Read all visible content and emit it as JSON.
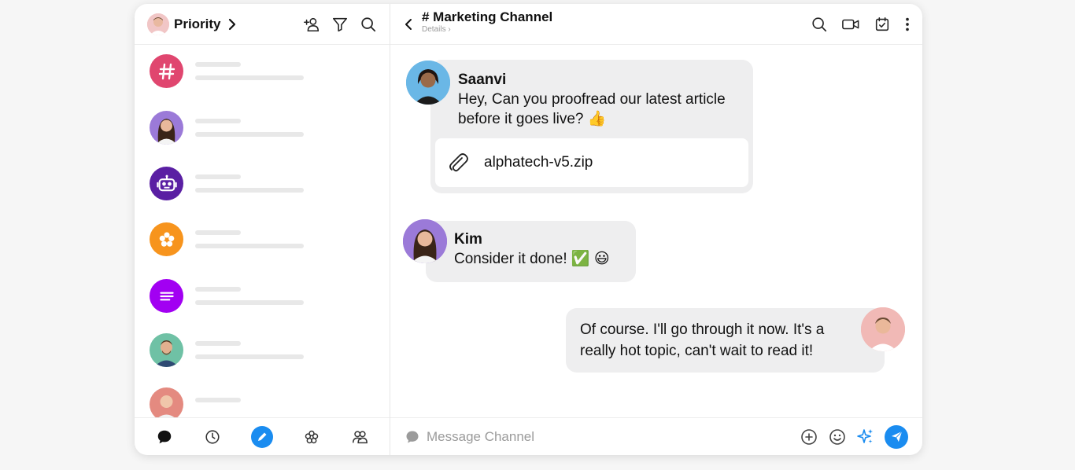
{
  "sidebar": {
    "title": "Priority",
    "icons": [
      "add-contact-icon",
      "filter-icon",
      "search-icon"
    ],
    "conversations": [
      {
        "avatar": "hashtag-channel-icon",
        "color": "#e0466f"
      },
      {
        "avatar": "woman-avatar",
        "color": "#9b7ad8"
      },
      {
        "avatar": "robot-icon",
        "color": "#5a1fa3"
      },
      {
        "avatar": "flower-icon",
        "color": "#f7941d"
      },
      {
        "avatar": "lines-icon",
        "color": "#a200f2"
      },
      {
        "avatar": "man-avatar",
        "color": "#6fc1a5"
      },
      {
        "avatar": "man-bald-avatar",
        "color": "#e48a80"
      }
    ],
    "nav": [
      "chat-icon",
      "clock-icon",
      "compose-icon",
      "apps-icon",
      "contacts-icon"
    ]
  },
  "chat": {
    "channel_title": "# Marketing Channel",
    "details_label": "Details",
    "header_icons": [
      "search-icon",
      "video-icon",
      "tasks-icon",
      "more-icon"
    ],
    "messages": [
      {
        "sender": "Saanvi",
        "text_line1": "Hey, Can you proofread our latest article",
        "text_line2": "before it goes live? 👍",
        "attachment": "alphatech-v5.zip"
      },
      {
        "sender": "Kim",
        "text": "Consider it done! ✅ 😃"
      },
      {
        "sender": "",
        "text_line1": "Of course. I'll go through it now. It's a",
        "text_line2": "really hot topic, can't wait to read it!"
      }
    ],
    "composer": {
      "placeholder": "Message Channel",
      "icons": [
        "add-icon",
        "emoji-icon",
        "ai-sparkle-icon",
        "send-icon"
      ]
    }
  },
  "colors": {
    "accent": "#1a8cf0",
    "bubble": "#eeeeef",
    "skeleton": "#e8e8e8"
  }
}
